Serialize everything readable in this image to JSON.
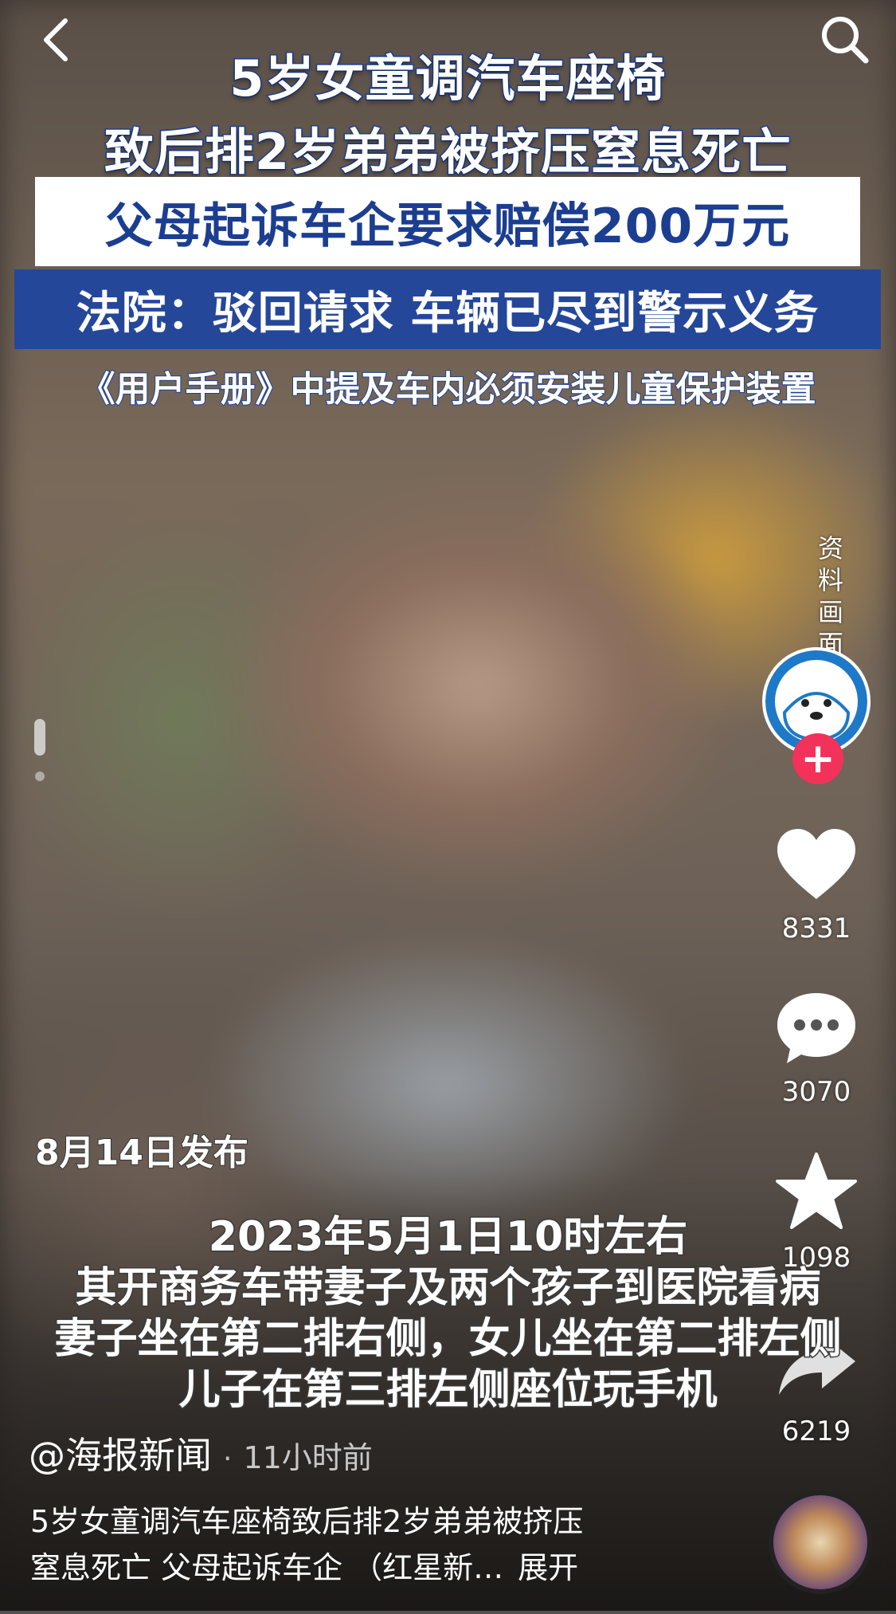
{
  "headline": {
    "line1": "5岁女童调汽车座椅",
    "line2": "致后排2岁弟弟被挤压窒息死亡",
    "line3": "父母起诉车企要求赔偿200万元",
    "line4": "法院：驳回请求 车辆已尽到警示义务",
    "line5": "《用户手册》中提及车内必须安装儿童保护装置"
  },
  "vertical_label": "资料画面",
  "publish_date": "8月14日发布",
  "subtitle": [
    "2023年5月1日10时左右",
    "其开商务车带妻子及两个孩子到医院看病",
    "妻子坐在第二排右侧，女儿坐在第二排左侧",
    "儿子在第三排左侧座位玩手机"
  ],
  "author": {
    "name": "@海报新闻",
    "time": "11小时前"
  },
  "description": {
    "line1": "5岁女童调汽车座椅致后排2岁弟弟被挤压",
    "line2": "窒息死亡 父母起诉车企 （红星新…",
    "expand": "展开"
  },
  "actions": {
    "likes": "8331",
    "comments": "3070",
    "favorites": "1098",
    "shares": "6219",
    "follow": "+"
  },
  "colors": {
    "headline_blue": "#25479a",
    "follow_red": "#f2325a"
  },
  "icons": [
    "back-icon",
    "search-icon",
    "heart-icon",
    "comment-icon",
    "star-icon",
    "share-icon"
  ]
}
